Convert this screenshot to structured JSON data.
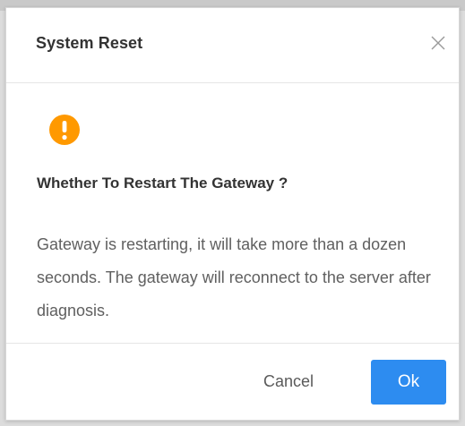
{
  "dialog": {
    "title": "System Reset",
    "close_icon": "close-icon",
    "warning_icon": "exclamation-circle-icon",
    "warning_color": "#ff9900",
    "question": "Whether To Restart The Gateway ?",
    "message": "Gateway is restarting, it will take more than a dozen seconds. The gateway will reconnect to the server after diagnosis.",
    "cancel_label": "Cancel",
    "ok_label": "Ok",
    "primary_color": "#2d8cf0"
  }
}
